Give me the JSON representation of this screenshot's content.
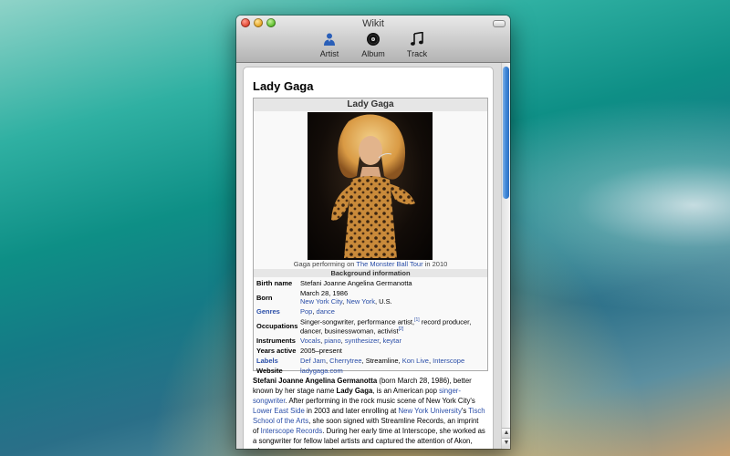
{
  "window": {
    "title": "Wikit"
  },
  "toolbar": {
    "artist_label": "Artist",
    "album_label": "Album",
    "track_label": "Track"
  },
  "article": {
    "heading": "Lady Gaga",
    "infobox": {
      "caption": "Lady Gaga",
      "photo_caption_before": "Gaga performing on ",
      "photo_caption_link": "The Monster Ball Tour",
      "photo_caption_after": " in 2010",
      "section_label": "Background information",
      "rows": {
        "birth_name": {
          "key": "Birth name",
          "value": "Stefani Joanne Angelina Germanotta"
        },
        "born": {
          "key": "Born",
          "date": "March 28, 1986",
          "link1": "New York City",
          "sep": ", ",
          "link2": "New York",
          "tail": ", U.S."
        },
        "genres": {
          "key": "Genres",
          "link1": "Pop",
          "sep": ", ",
          "link2": "dance"
        },
        "occupations": {
          "key": "Occupations",
          "text1": "Singer-songwriter, performance artist,",
          "ref1": "[1]",
          "text2": " record producer, dancer, businesswoman, activist",
          "ref2": "[2]"
        },
        "instruments": {
          "key": "Instruments",
          "link1": "Vocals",
          "link2": "piano",
          "link3": "synthesizer",
          "link4": "keytar",
          "sep": ", "
        },
        "years_active": {
          "key": "Years active",
          "value": "2005–present"
        },
        "labels": {
          "key": "Labels",
          "link1": "Def Jam",
          "link2": "Cherrytree",
          "text3": "Streamline",
          "link4": "Kon Live",
          "link5": "Interscope",
          "sep": ", "
        },
        "website": {
          "key": "Website",
          "link": "ladygaga.com"
        }
      }
    },
    "body": {
      "bold1": "Stefani Joanne Angelina Germanotta",
      "t1": " (born March 28, 1986), better known by her stage name ",
      "bold2": "Lady Gaga",
      "t2": ", is an American pop ",
      "link1": "singer-songwriter",
      "t3": ". After performing in the rock music scene of New York City's ",
      "link2": "Lower East Side",
      "t4": " in 2003 and later enrolling at ",
      "link3": "New York University",
      "t5": "'s ",
      "link4": "Tisch School of the Arts",
      "t6": ", she soon signed with Streamline Records, an imprint of ",
      "link5": "Interscope Records",
      "t7": ". During her early time at Interscope, she worked as a songwriter for fellow label artists and captured the attention of Akon, who recognized her vocal"
    }
  },
  "colors": {
    "link": "#2a4ea8",
    "scroll_thumb": "#3f86d6"
  }
}
